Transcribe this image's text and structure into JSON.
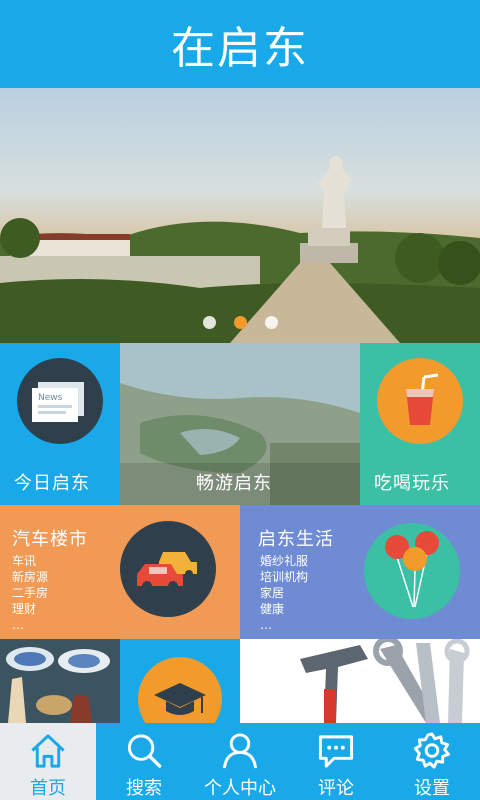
{
  "header": {
    "title": "在启东"
  },
  "banner": {
    "slides": 3,
    "active_slide": 2
  },
  "tiles": {
    "today": {
      "label": "今日启东",
      "icon": "newspaper-icon",
      "icon_text": "News"
    },
    "travel": {
      "label": "畅游启东"
    },
    "food": {
      "label": "吃喝玩乐",
      "icon": "drink-icon"
    },
    "cars": {
      "label": "汽车楼市",
      "icon": "cars-icon",
      "items": [
        "车讯",
        "新房源",
        "二手房",
        "理财",
        "…"
      ]
    },
    "life": {
      "label": "启东生活",
      "icon": "balloons-icon",
      "items": [
        "婚纱礼服",
        "培训机构",
        "家居",
        "健康",
        "…"
      ]
    },
    "education": {
      "icon": "graduation-cap-icon"
    },
    "tools": {
      "icon": "tools-icon"
    },
    "antiques": {
      "icon": "antiques-photo"
    }
  },
  "tabbar": [
    {
      "label": "首页",
      "icon": "home-icon",
      "active": true
    },
    {
      "label": "搜索",
      "icon": "search-icon",
      "active": false
    },
    {
      "label": "个人中心",
      "icon": "user-icon",
      "active": false
    },
    {
      "label": "评论",
      "icon": "comment-icon",
      "active": false
    },
    {
      "label": "设置",
      "icon": "gear-icon",
      "active": false
    }
  ],
  "colors": {
    "primary": "#19a9e8",
    "orange": "#f29a2b",
    "teal": "#3bbfa5",
    "salmon": "#f09a56",
    "periwinkle": "#6f8bd3",
    "dark_circle": "#2f3f4c"
  }
}
